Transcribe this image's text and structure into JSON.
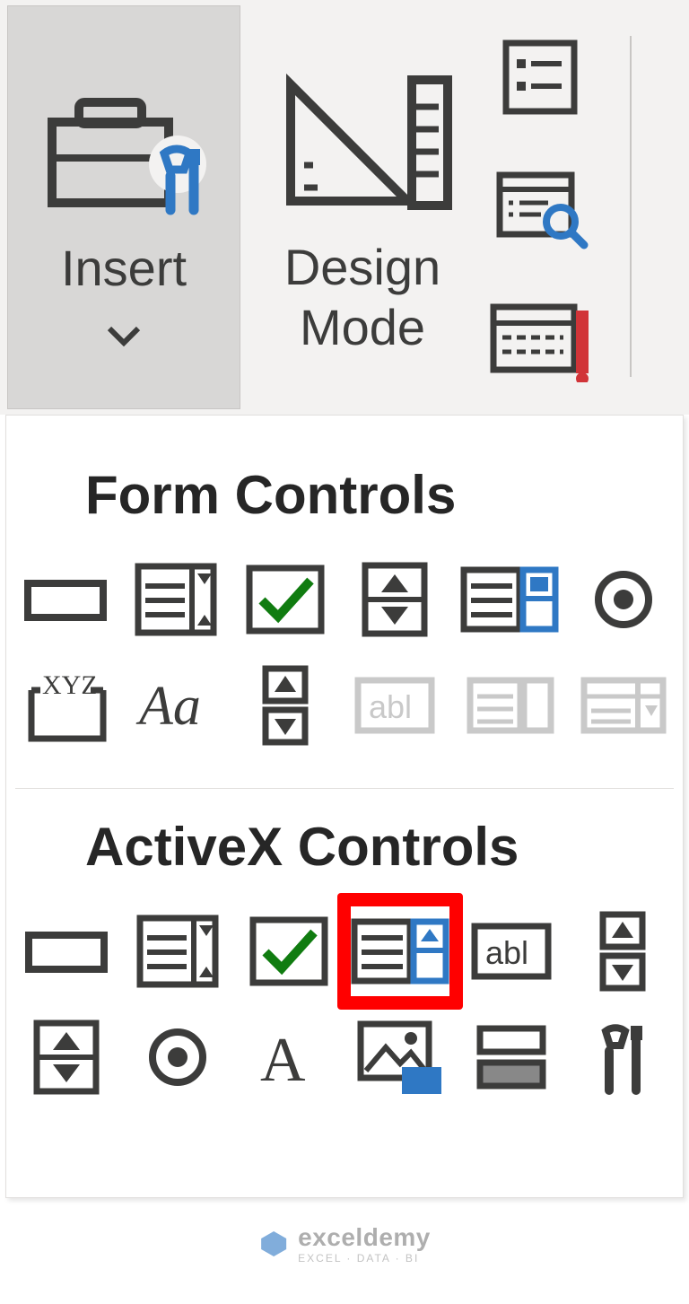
{
  "ribbon": {
    "insert_label": "Insert",
    "design_label": "Design\nMode"
  },
  "dropdown": {
    "form_title": "Form Controls",
    "activex_title": "ActiveX Controls",
    "form_controls": [
      "button",
      "combo-box",
      "check-box",
      "spin-button",
      "list-box",
      "option-button",
      "group-box",
      "label",
      "scroll-bar",
      "text-field",
      "combo-list",
      "combo-dropdown"
    ],
    "activex_controls": [
      "command-button",
      "combo-box",
      "check-box",
      "list-box",
      "text-box",
      "scroll-bar",
      "spin-button",
      "option-button",
      "label",
      "image",
      "toggle-button",
      "more-controls"
    ]
  },
  "watermark": {
    "brand": "exceldemy",
    "tagline": "EXCEL · DATA · BI"
  },
  "highlight": "list-box"
}
